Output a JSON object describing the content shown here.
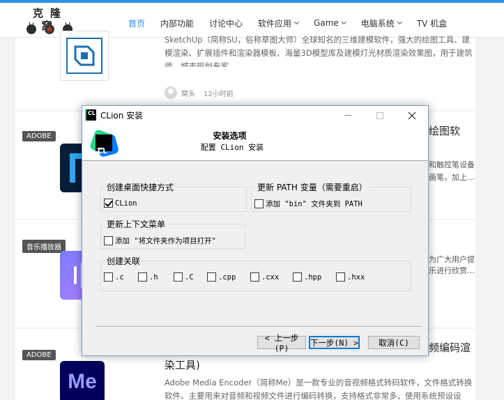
{
  "site": {
    "logo_text": "克隆窝",
    "nav": [
      {
        "label": "首页",
        "active": true,
        "has_dropdown": false
      },
      {
        "label": "内部功能",
        "active": false,
        "has_dropdown": false
      },
      {
        "label": "讨论中心",
        "active": false,
        "has_dropdown": false
      },
      {
        "label": "软件应用",
        "active": false,
        "has_dropdown": true
      },
      {
        "label": "Game",
        "active": false,
        "has_dropdown": true
      },
      {
        "label": "电脑系统",
        "active": false,
        "has_dropdown": true
      },
      {
        "label": "TV 机盒",
        "active": false,
        "has_dropdown": false
      }
    ],
    "posts": {
      "sketchup": {
        "desc": "SketchUp（简称SU，俗称草图大师）全球知名的三维建模软件，强大的绘图工具、建模渲染、扩展插件和渲染器模板、海量3D模型库及建模灯光材质渲染效果图，用于建筑师、城市规划专家",
        "author": "窝头",
        "time": "12小时前"
      },
      "adobe_fresco": {
        "tag": "ADOBE",
        "title_frag": "绘图软",
        "side_frag_1": "和触控笔设备",
        "side_frag_2": "画笔，加上…"
      },
      "music": {
        "tag": "音乐播放器",
        "side_frag_1": "为广大用户提",
        "side_frag_2": "乐进行欣赏…"
      },
      "media_encoder": {
        "tag": "ADOBE",
        "title_frag_1": "频编码渲",
        "title_frag_2": "染工具)",
        "desc": "Adobe Media Encoder（简称Me）是一款专业的音视频格式转码软件，文件格式转换软件。主要用来对音频和视频文件进行编码转换，支持格式非常多，使用系统预设设置，能更好的…",
        "thumb_text": "Me"
      }
    }
  },
  "dialog": {
    "app_icon_text": "CL",
    "title": "CLion 安装",
    "header_title": "安装选项",
    "header_subtitle": "配置 CLion 安装",
    "shortcut_group": {
      "label": "创建桌面快捷方式",
      "option": {
        "label": "CLion",
        "checked": true
      }
    },
    "path_group": {
      "label": "更新 PATH 变量（需要重启）",
      "option": {
        "label": "添加 \"bin\" 文件夹到 PATH",
        "checked": false
      }
    },
    "context_group": {
      "label": "更新上下文菜单",
      "option": {
        "label": "添加 \"将文件夹作为项目打开\"",
        "checked": false
      }
    },
    "assoc_group": {
      "label": "创建关联",
      "options": [
        {
          "label": ".c",
          "checked": false
        },
        {
          "label": ".h",
          "checked": false
        },
        {
          "label": ".C",
          "checked": false
        },
        {
          "label": ".cpp",
          "checked": false
        },
        {
          "label": ".cxx",
          "checked": false
        },
        {
          "label": ".hpp",
          "checked": false
        },
        {
          "label": ".hxx",
          "checked": false
        }
      ]
    },
    "buttons": {
      "back": "< 上一步(P)",
      "next": "下一步(N) >",
      "cancel": "取消(C)"
    }
  }
}
